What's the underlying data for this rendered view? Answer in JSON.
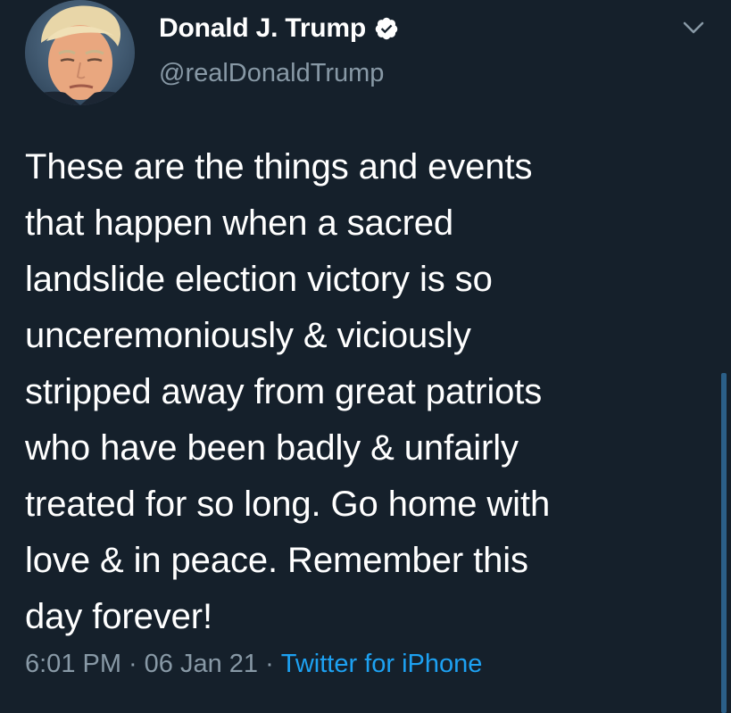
{
  "tweet": {
    "author": {
      "display_name": "Donald J. Trump",
      "handle": "@realDonaldTrump",
      "verified": true,
      "avatar": "profile-photo"
    },
    "text": "These are the things and events\nthat happen when a sacred\nlandslide election victory is so\nunceremoniously & viciously\nstripped away from great patriots\nwho have been badly & unfairly\ntreated for so long. Go home with\nlove & in peace. Remember this\nday forever!",
    "time": "6:01 PM",
    "separator": "·",
    "date": "06 Jan 21",
    "source": "Twitter for iPhone"
  },
  "icons": {
    "verified": "verified-badge-icon",
    "menu": "chevron-down-icon"
  },
  "colors": {
    "background": "#15202b",
    "primary_text": "#ffffff",
    "secondary_text": "#8899a6",
    "link": "#1da1f2",
    "scrollbar": "#2b5f88"
  }
}
